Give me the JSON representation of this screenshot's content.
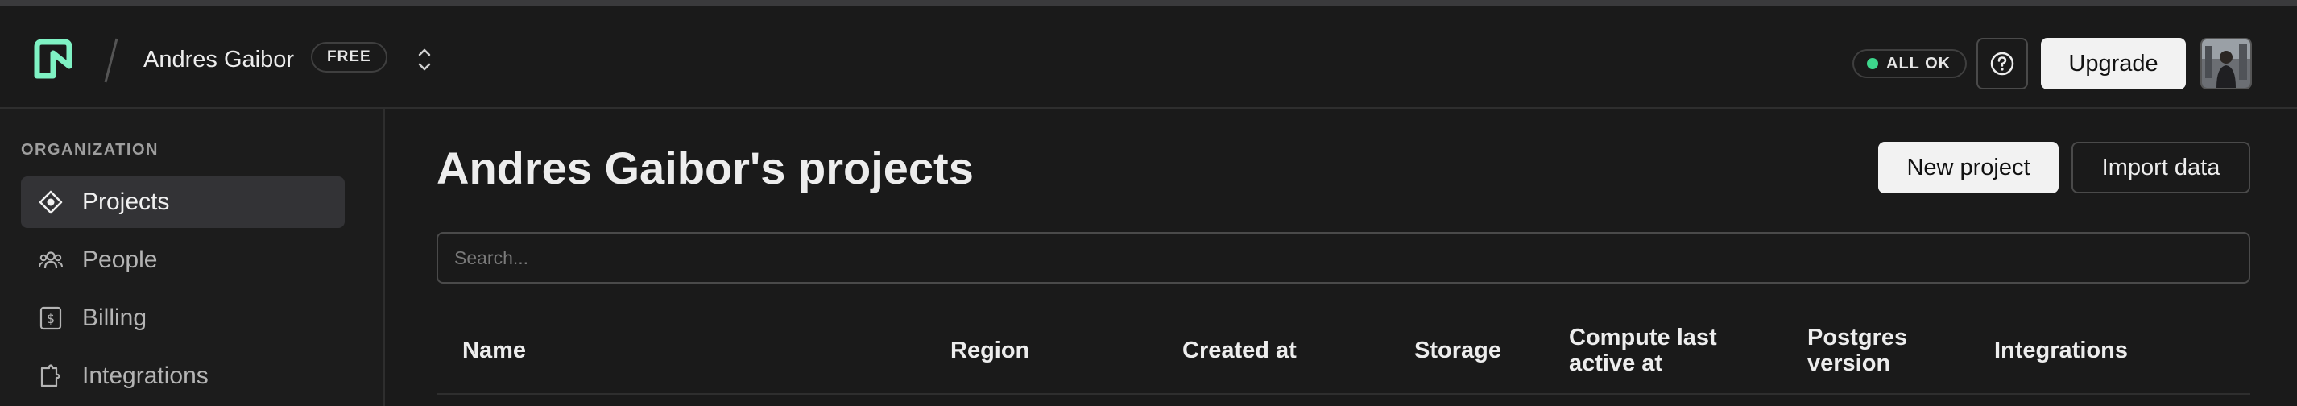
{
  "header": {
    "org_name": "Andres Gaibor",
    "plan": "FREE",
    "status": "ALL OK",
    "upgrade_label": "Upgrade",
    "colors": {
      "logo": "#7ff2c4",
      "status_ok": "#3dd68c"
    }
  },
  "sidebar": {
    "heading": "ORGANIZATION",
    "items": [
      {
        "label": "Projects",
        "icon": "projects-icon",
        "active": true
      },
      {
        "label": "People",
        "icon": "people-icon",
        "active": false
      },
      {
        "label": "Billing",
        "icon": "billing-icon",
        "active": false
      },
      {
        "label": "Integrations",
        "icon": "integrations-icon",
        "active": false
      }
    ]
  },
  "main": {
    "title": "Andres Gaibor's projects",
    "new_project_label": "New project",
    "import_label": "Import data",
    "search_placeholder": "Search...",
    "columns": [
      {
        "label": "Name"
      },
      {
        "label": "Region"
      },
      {
        "label": "Created at"
      },
      {
        "label": "Storage"
      },
      {
        "label": "Compute last active at"
      },
      {
        "label": "Postgres version"
      },
      {
        "label": "Integrations"
      }
    ]
  }
}
